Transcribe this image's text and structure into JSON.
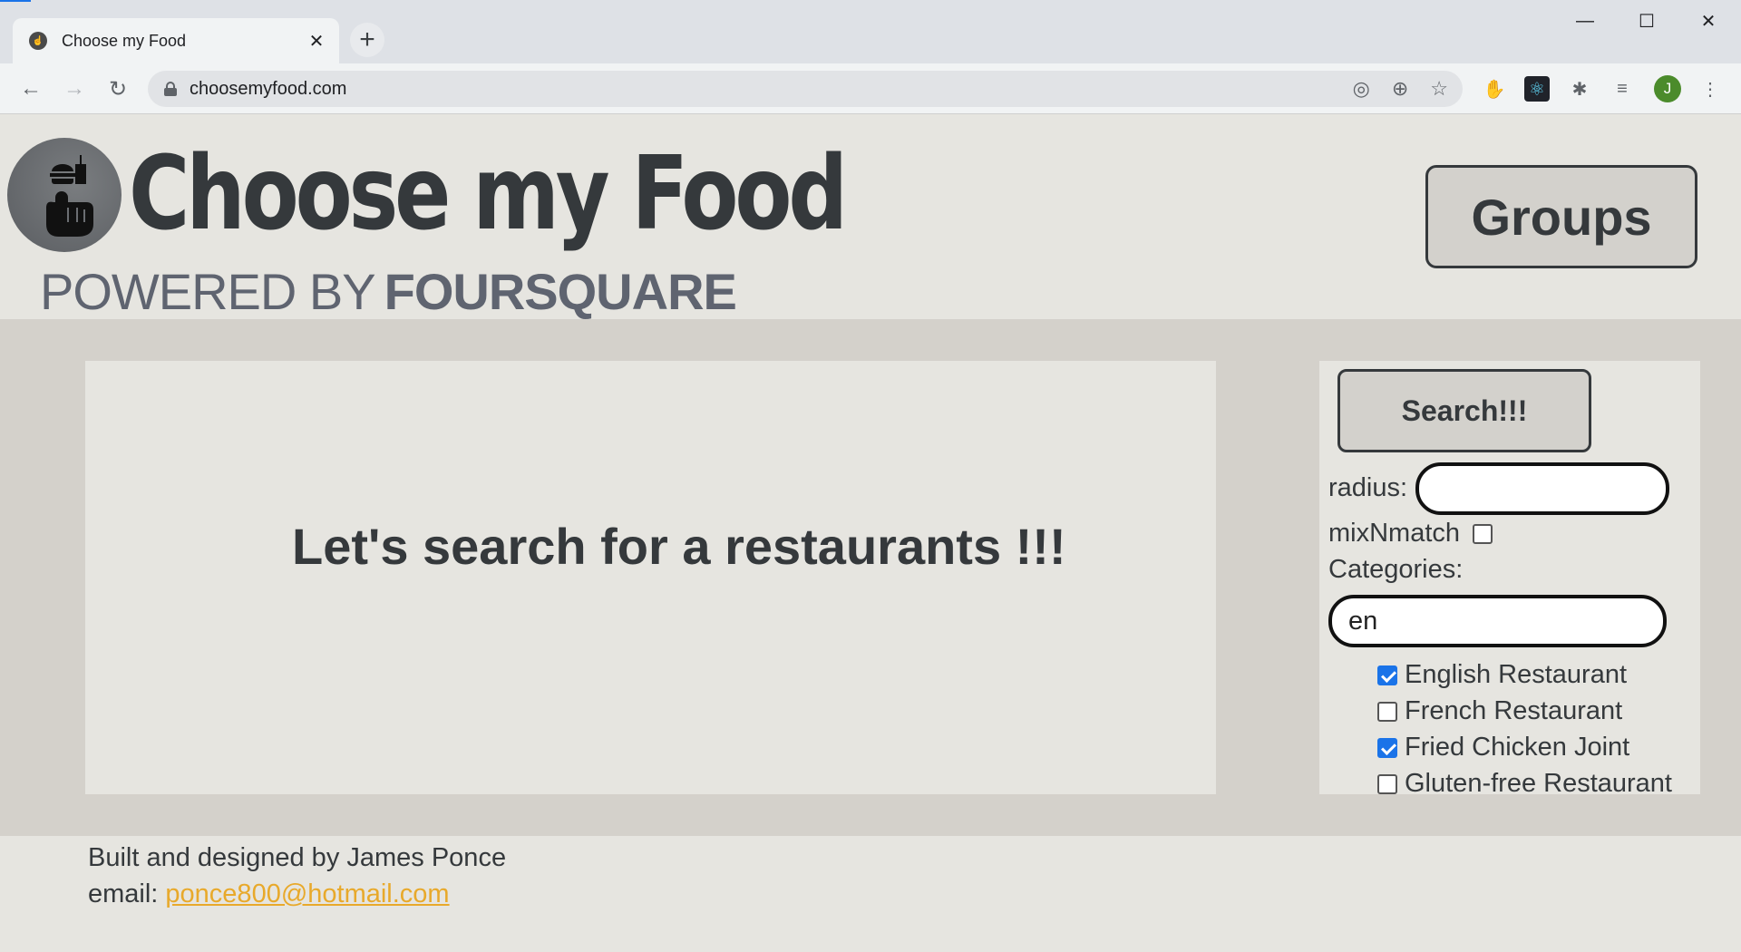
{
  "browser": {
    "tab_title": "Choose my Food",
    "url": "choosemyfood.com",
    "new_tab_label": "+",
    "tab_close_label": "✕",
    "avatar_letter": "J"
  },
  "header": {
    "title": "Choose my Food",
    "powered_by": "POWERED BY",
    "powered_brand": "FOURSQUARE",
    "groups_button": "Groups"
  },
  "results": {
    "message": "Let's search for a restaurants !!!"
  },
  "sidebar": {
    "search_button": "Search!!!",
    "radius_label": "radius:",
    "radius_value": "",
    "mixnmatch_label": "mixNmatch",
    "mixnmatch_checked": false,
    "categories_label": "Categories:",
    "categories_query": "en",
    "categories": [
      {
        "label": "English Restaurant",
        "checked": true
      },
      {
        "label": "French Restaurant",
        "checked": false
      },
      {
        "label": "Fried Chicken Joint",
        "checked": true
      },
      {
        "label": "Gluten-free Restaurant",
        "checked": false
      }
    ]
  },
  "footer": {
    "credit": "Built and designed by James Ponce",
    "email_label": "email:",
    "email": "ponce800@hotmail.com"
  },
  "colors": {
    "page_bg": "#e6e5e0",
    "band_bg": "#d4d1cb",
    "text": "#35393c",
    "link": "#e8a92b",
    "checkbox": "#1a73e8"
  }
}
